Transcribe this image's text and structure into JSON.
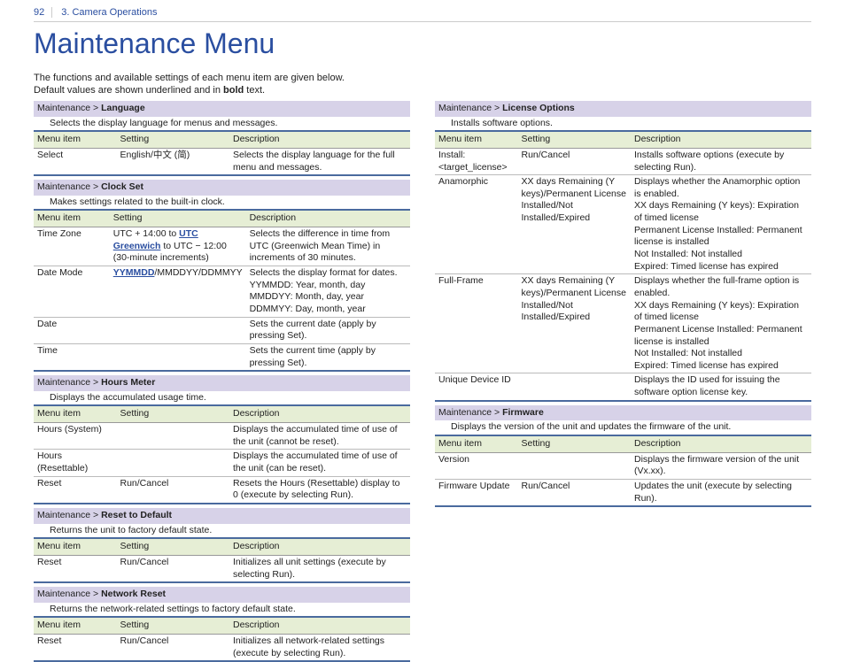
{
  "page": {
    "number": "92",
    "section": "3. Camera Operations"
  },
  "title": "Maintenance Menu",
  "intro1": "The functions and available settings of each menu item are given below.",
  "intro2a": "Default values are shown underlined and in ",
  "intro2b": "bold",
  "intro2c": " text.",
  "hdr": {
    "menu": "Menu item",
    "setting": "Setting",
    "desc": "Description"
  },
  "left": {
    "lang": {
      "pathA": "Maintenance > ",
      "pathB": "Language",
      "desc": "Selects the display language for menus and messages.",
      "rows": [
        {
          "m": "Select",
          "s": "English/中文 (简)",
          "d": "Selects the display language for the full menu and messages."
        }
      ]
    },
    "clock": {
      "pathA": "Maintenance > ",
      "pathB": "Clock Set",
      "desc": "Makes settings related to the built-in clock.",
      "rows": [
        {
          "m": "Time Zone",
          "s1": "UTC + 14:00 to ",
          "s2": "UTC Greenwich",
          "s3": " to UTC − 12:00 (30-minute increments)",
          "d": "Selects the difference in time from UTC (Greenwich Mean Time) in increments of 30 minutes."
        },
        {
          "m": "Date Mode",
          "s1": "",
          "s2": "YYMMDD",
          "s3": "/MMDDYY/DDMMYY",
          "d": "Selects the display format for dates.\nYYMMDD: Year, month, day\nMMDDYY: Month, day, year\nDDMMYY: Day, month, year"
        },
        {
          "m": "Date",
          "s": "",
          "d": "Sets the current date (apply by pressing Set)."
        },
        {
          "m": "Time",
          "s": "",
          "d": "Sets the current time (apply by pressing Set)."
        }
      ]
    },
    "hours": {
      "pathA": "Maintenance > ",
      "pathB": "Hours Meter",
      "desc": "Displays the accumulated usage time.",
      "rows": [
        {
          "m": "Hours (System)",
          "s": "",
          "d": "Displays the accumulated time of use of the unit (cannot be reset)."
        },
        {
          "m": "Hours (Resettable)",
          "s": "",
          "d": "Displays the accumulated time of use of the unit (can be reset)."
        },
        {
          "m": "Reset",
          "s": "Run/Cancel",
          "d": "Resets the Hours (Resettable) display to 0 (execute by selecting Run)."
        }
      ]
    },
    "reset": {
      "pathA": "Maintenance > ",
      "pathB": "Reset to Default",
      "desc": "Returns the unit to factory default state.",
      "rows": [
        {
          "m": "Reset",
          "s": "Run/Cancel",
          "d": "Initializes all unit settings (execute by selecting Run)."
        }
      ]
    },
    "net": {
      "pathA": "Maintenance > ",
      "pathB": "Network Reset",
      "desc": "Returns the network-related settings to factory default state.",
      "rows": [
        {
          "m": "Reset",
          "s": "Run/Cancel",
          "d": "Initializes all network-related settings (execute by selecting Run)."
        }
      ]
    }
  },
  "right": {
    "lic": {
      "pathA": "Maintenance > ",
      "pathB": "License Options",
      "desc": "Installs software options.",
      "rows": [
        {
          "m": "Install: <target_license>",
          "s": "Run/Cancel",
          "d": "Installs software options (execute by selecting Run)."
        },
        {
          "m": "Anamorphic",
          "s": "XX days Remaining (Y keys)/Permanent License Installed/Not Installed/Expired",
          "d": "Displays whether the Anamorphic option is enabled.\nXX days Remaining (Y keys): Expiration of timed license\nPermanent License Installed: Permanent license is installed\nNot Installed: Not installed\nExpired: Timed license has expired"
        },
        {
          "m": "Full-Frame",
          "s": "XX days Remaining (Y keys)/Permanent License Installed/Not Installed/Expired",
          "d": "Displays whether the full-frame option is enabled.\nXX days Remaining (Y keys): Expiration of timed license\nPermanent License Installed: Permanent license is installed\nNot Installed: Not installed\nExpired: Timed license has expired"
        },
        {
          "m": "Unique Device ID",
          "s": "",
          "d": "Displays the ID used for issuing the software option license key."
        }
      ]
    },
    "fw": {
      "pathA": "Maintenance > ",
      "pathB": "Firmware",
      "desc": "Displays the version of the unit and updates the firmware of the unit.",
      "rows": [
        {
          "m": "Version",
          "s": "",
          "d": "Displays the firmware version of the unit (Vx.xx)."
        },
        {
          "m": "Firmware Update",
          "s": "Run/Cancel",
          "d": "Updates the unit (execute by selecting Run)."
        }
      ]
    }
  }
}
